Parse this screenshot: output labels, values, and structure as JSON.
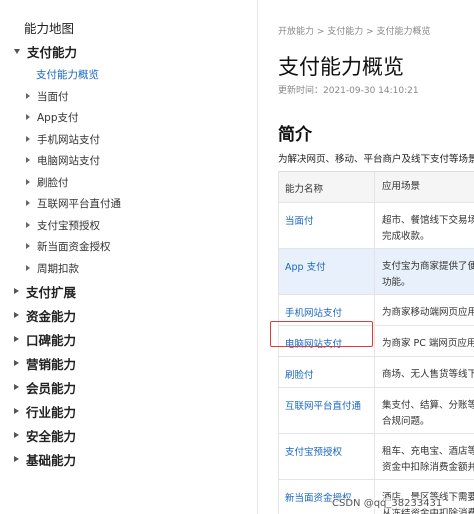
{
  "sidebar": {
    "root": "能力地图",
    "items": [
      {
        "label": "支付能力",
        "level": "top",
        "expanded": true
      },
      {
        "label": "支付能力概览",
        "level": "sub",
        "active": true
      },
      {
        "label": "当面付",
        "level": "sub"
      },
      {
        "label": "App支付",
        "level": "sub"
      },
      {
        "label": "手机网站支付",
        "level": "sub"
      },
      {
        "label": "电脑网站支付",
        "level": "sub"
      },
      {
        "label": "刷脸付",
        "level": "sub"
      },
      {
        "label": "互联网平台直付通",
        "level": "sub"
      },
      {
        "label": "支付宝预授权",
        "level": "sub"
      },
      {
        "label": "新当面资金授权",
        "level": "sub"
      },
      {
        "label": "周期扣款",
        "level": "sub"
      },
      {
        "label": "支付扩展",
        "level": "top"
      },
      {
        "label": "资金能力",
        "level": "top"
      },
      {
        "label": "口碑能力",
        "level": "top"
      },
      {
        "label": "营销能力",
        "level": "top"
      },
      {
        "label": "会员能力",
        "level": "top"
      },
      {
        "label": "行业能力",
        "level": "top"
      },
      {
        "label": "安全能力",
        "level": "top"
      },
      {
        "label": "基础能力",
        "level": "top"
      }
    ]
  },
  "content": {
    "breadcrumb": "开放能力 > 支付能力 > 支付能力概览",
    "title": "支付能力概览",
    "updated": "更新时间：2021-09-30 14:10:21",
    "section_title": "简介",
    "intro": "为解决网页、移动、平台商户及线下支付等场景",
    "table": {
      "headers": [
        "能力名称",
        "应用场景"
      ],
      "rows": [
        {
          "name": "当面付",
          "desc": "超市、餐馆线下交易场\n完成收款。"
        },
        {
          "name": "App 支付",
          "desc": "支付宝为商家提供了便\n功能。",
          "highlight": true
        },
        {
          "name": "手机网站支付",
          "desc": "为商家移动端网页应用"
        },
        {
          "name": "电脑网站支付",
          "desc": "为商家 PC 端网页应用"
        },
        {
          "name": "刷脸付",
          "desc": "商场、无人售货等线下"
        },
        {
          "name": "互联网平台直付通",
          "desc": "集支付、结算、分账等\n合规问题。"
        },
        {
          "name": "支付宝预授权",
          "desc": "租车、充电宝、酒店等\n资金中扣除消费金额并"
        },
        {
          "name": "新当面资金授权",
          "desc": "酒店、景区等线下需要\n从冻结资金中扣除消费"
        }
      ]
    }
  },
  "watermark": "CSDN @qq_38233431",
  "colors": {
    "link": "#1a66c2",
    "highlight_border": "#e0393e"
  }
}
